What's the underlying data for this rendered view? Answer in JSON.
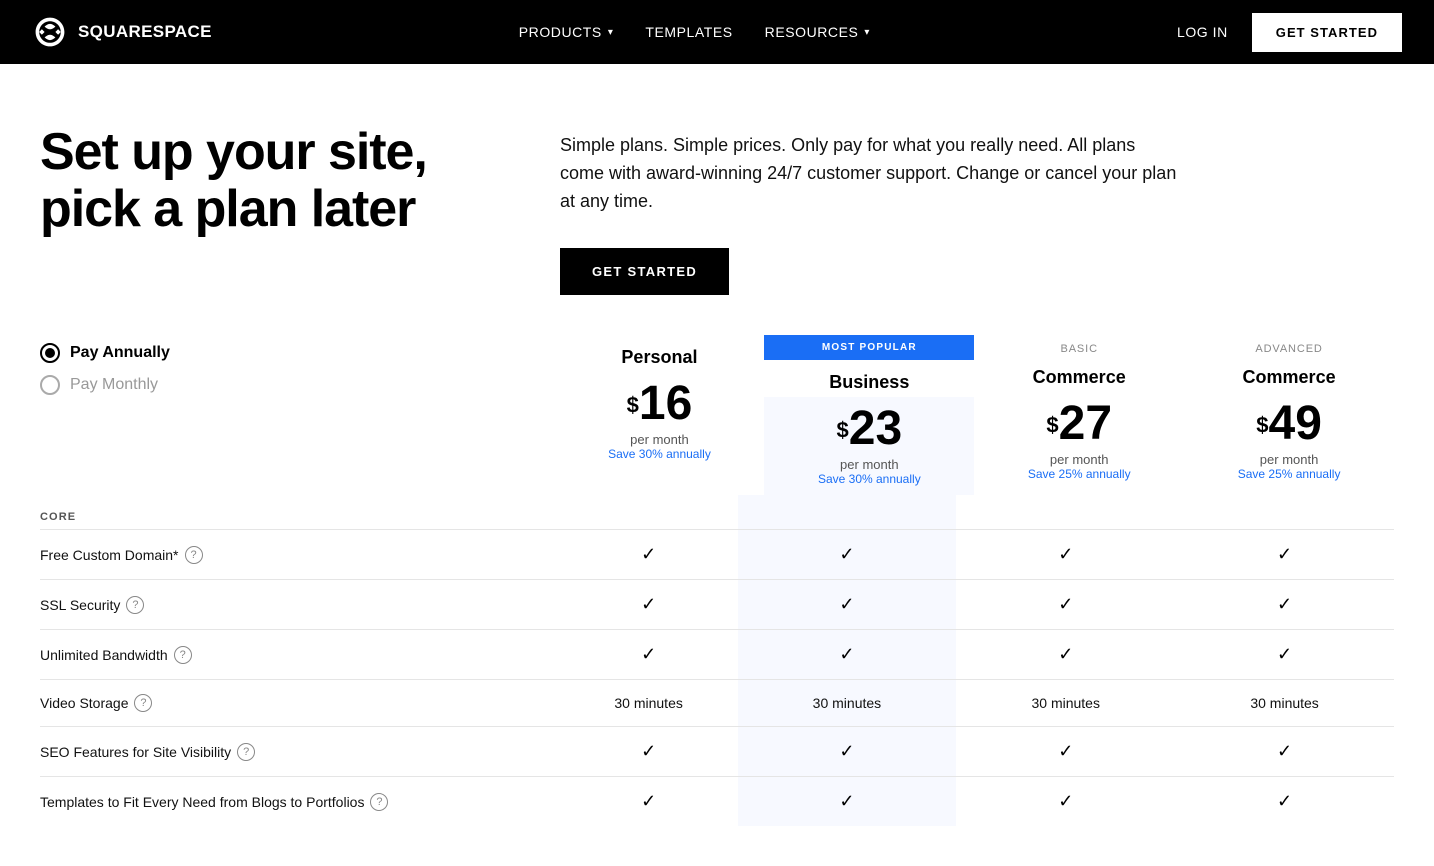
{
  "nav": {
    "logo_text": "SQUARESPACE",
    "items": [
      {
        "label": "PRODUCTS",
        "has_dropdown": true
      },
      {
        "label": "TEMPLATES",
        "has_dropdown": false
      },
      {
        "label": "RESOURCES",
        "has_dropdown": true
      }
    ],
    "login_label": "LOG IN",
    "cta_label": "GET STARTED"
  },
  "hero": {
    "title": "Set up your site, pick a plan later",
    "description": "Simple plans. Simple prices. Only pay for what you really need. All plans come with award-winning 24/7 customer support. Change or cancel your plan at any time.",
    "cta_label": "GET STARTED"
  },
  "billing": {
    "annually_label": "Pay Annually",
    "monthly_label": "Pay Monthly",
    "selected": "annually"
  },
  "plans": [
    {
      "id": "personal",
      "name": "Personal",
      "sub": "",
      "most_popular": false,
      "price": "16",
      "per_month": "per month",
      "save": "Save 30% annually"
    },
    {
      "id": "business",
      "name": "Business",
      "sub": "",
      "most_popular": true,
      "most_popular_label": "MOST POPULAR",
      "price": "23",
      "per_month": "per month",
      "save": "Save 30% annually"
    },
    {
      "id": "commerce-basic",
      "name": "Commerce",
      "sub": "BASIC",
      "most_popular": false,
      "price": "27",
      "per_month": "per month",
      "save": "Save 25% annually"
    },
    {
      "id": "commerce-advanced",
      "name": "Commerce",
      "sub": "ADVANCED",
      "most_popular": false,
      "price": "49",
      "per_month": "per month",
      "save": "Save 25% annually"
    }
  ],
  "core_section_label": "CORE",
  "features": [
    {
      "name": "Free Custom Domain*",
      "has_info": true,
      "personal": "check",
      "business": "check",
      "commerce_basic": "check",
      "commerce_advanced": "check"
    },
    {
      "name": "SSL Security",
      "has_info": true,
      "personal": "check",
      "business": "check",
      "commerce_basic": "check",
      "commerce_advanced": "check"
    },
    {
      "name": "Unlimited Bandwidth",
      "has_info": true,
      "personal": "check",
      "business": "check",
      "commerce_basic": "check",
      "commerce_advanced": "check"
    },
    {
      "name": "Video Storage",
      "has_info": true,
      "personal": "30 minutes",
      "business": "30 minutes",
      "commerce_basic": "30 minutes",
      "commerce_advanced": "30 minutes"
    },
    {
      "name": "SEO Features for Site Visibility",
      "has_info": true,
      "personal": "check",
      "business": "check",
      "commerce_basic": "check",
      "commerce_advanced": "check"
    },
    {
      "name": "Templates to Fit Every Need from Blogs to Portfolios",
      "has_info": true,
      "personal": "check",
      "business": "check",
      "commerce_basic": "check",
      "commerce_advanced": "check"
    }
  ],
  "colors": {
    "accent": "#1a6ef5",
    "nav_bg": "#000000",
    "highlight_col": "#f7f9ff"
  }
}
